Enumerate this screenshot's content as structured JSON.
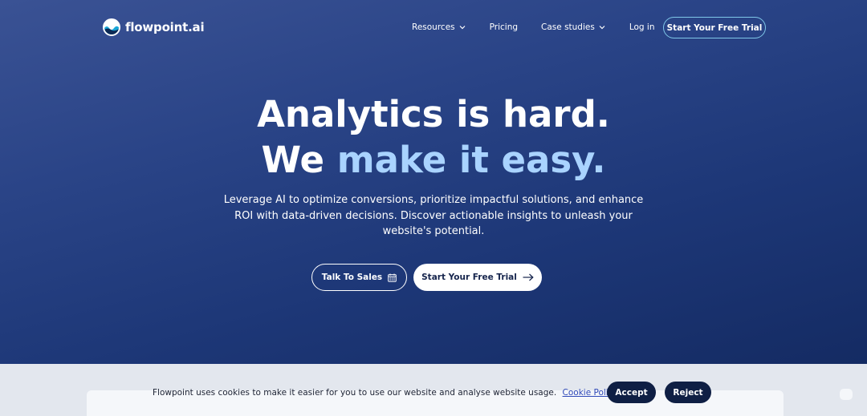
{
  "brand": {
    "name": "flowpoint.ai",
    "logo_icon": "wave-circle-icon"
  },
  "nav": {
    "items": [
      {
        "label": "Resources",
        "has_dropdown": true
      },
      {
        "label": "Pricing",
        "has_dropdown": false
      },
      {
        "label": "Case studies",
        "has_dropdown": true
      },
      {
        "label": "Log in",
        "has_dropdown": false
      }
    ],
    "cta_label": "Start Your Free Trial"
  },
  "hero": {
    "title_line1": "Analytics is hard.",
    "title_line2_part1": "We",
    "title_line2_part2": "make it easy.",
    "description": "Leverage AI to optimize conversions, prioritize impactful solutions, and enhance ROI with data-driven decisions. Discover actionable insights to unleash your website's potential.",
    "sales_button": "Talk To Sales",
    "sales_icon": "calendar-icon",
    "trial_button": "Start Your Free Trial",
    "trial_icon": "arrow-right-icon"
  },
  "cookie": {
    "text": "Flowpoint uses cookies to make it easier for you to use our website and analyse website usage.",
    "link": "Cookie Policy",
    "accept": "Accept",
    "reject": "Reject"
  },
  "colors": {
    "bg_top": "#3a5294",
    "bg_bottom": "#12285e",
    "accent_light_blue": "#a9d3ff",
    "cta_border": "#7fc7e8",
    "dark_button": "#0f1f44"
  }
}
